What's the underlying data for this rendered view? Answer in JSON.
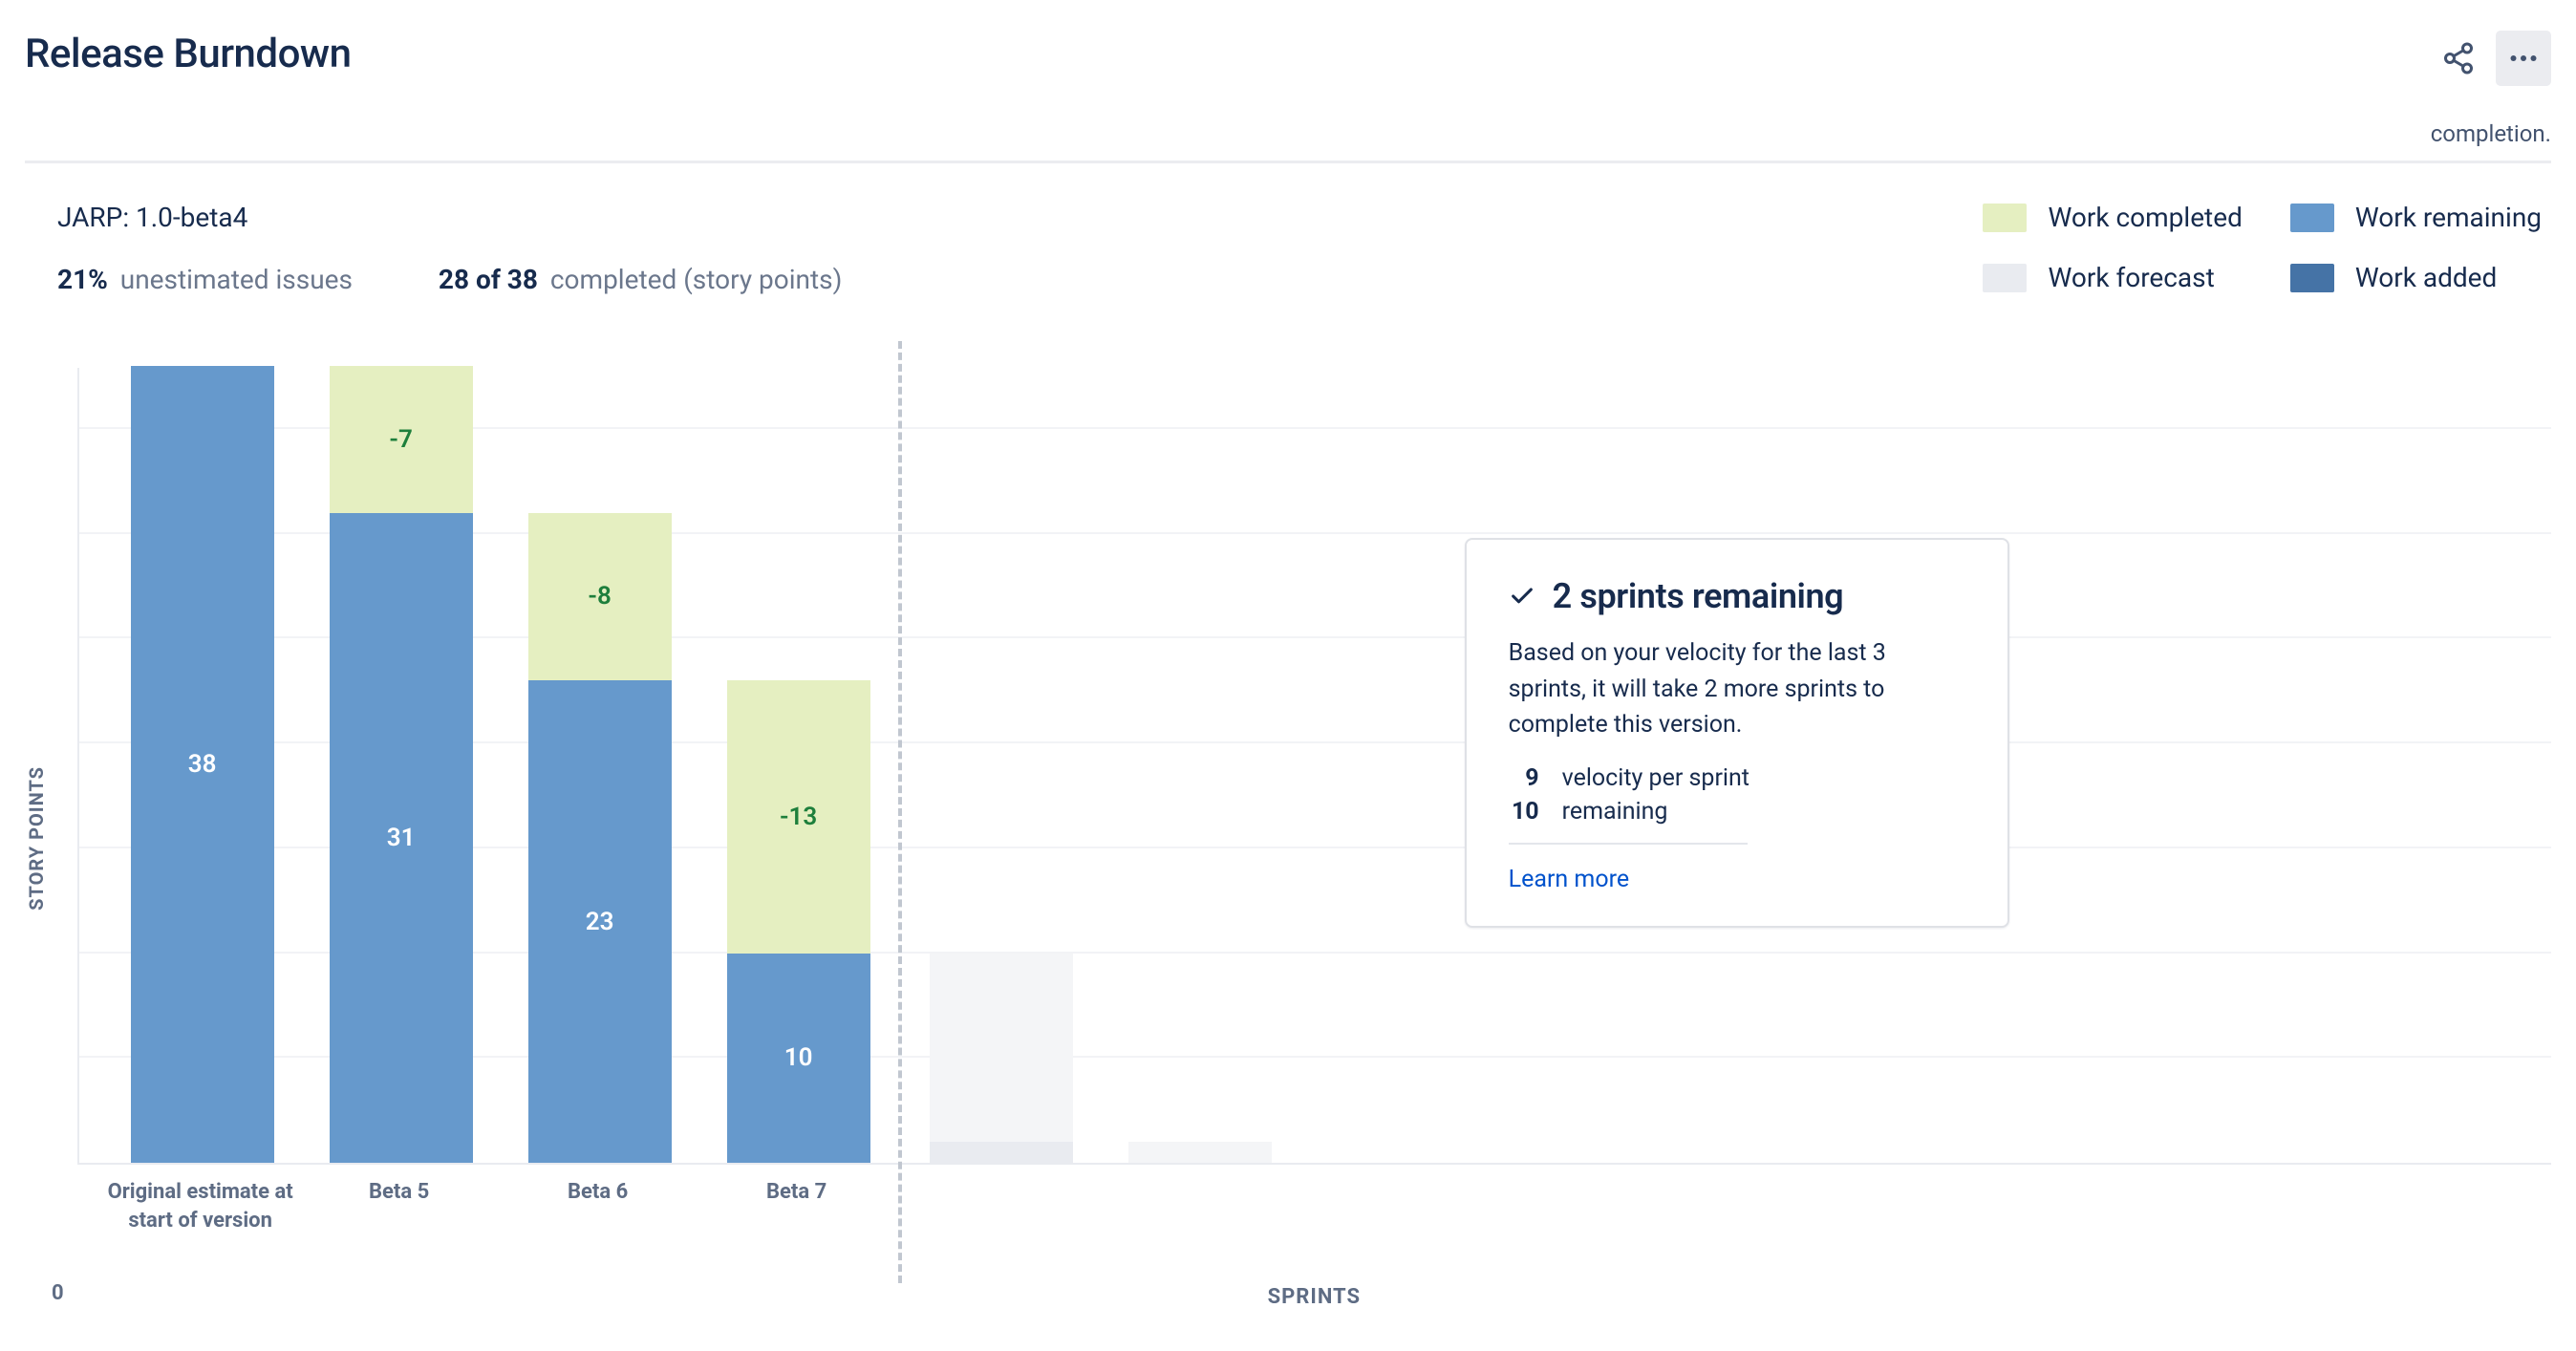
{
  "header": {
    "title": "Release Burndown",
    "meta_right": "completion."
  },
  "sub": {
    "version": "JARP: 1.0-beta4",
    "stat1_value": "21%",
    "stat1_label": "unestimated issues",
    "stat2_value": "28 of 38",
    "stat2_label": "completed (story points)"
  },
  "legend": {
    "work_completed": "Work completed",
    "work_remaining": "Work remaining",
    "work_forecast": "Work forecast",
    "work_added": "Work added",
    "colors": {
      "completed": "#e5efc1",
      "remaining": "#6699cc",
      "forecast": "#e9ebf0",
      "added": "#4573a6"
    }
  },
  "axes": {
    "y_title": "STORY POINTS",
    "y_zero": "0",
    "x_title": "SPRINTS"
  },
  "forecast_card": {
    "title": "2 sprints remaining",
    "body": "Based on your velocity for the last 3 sprints, it will take 2 more sprints to complete this version.",
    "velocity_value": "9",
    "velocity_label": "velocity per sprint",
    "remaining_value": "10",
    "remaining_label": "remaining",
    "learn_more": "Learn more"
  },
  "chart_data": {
    "type": "bar",
    "title": "Release Burndown",
    "xlabel": "SPRINTS",
    "ylabel": "STORY POINTS",
    "ylim": [
      0,
      38
    ],
    "gridlines": [
      5,
      10,
      15,
      20,
      25,
      30,
      35
    ],
    "categories": [
      "Original estimate at start of version",
      "Beta 5",
      "Beta 6",
      "Beta 7"
    ],
    "series": [
      {
        "name": "Work remaining",
        "values": [
          38,
          31,
          23,
          10
        ]
      },
      {
        "name": "Work completed",
        "values": [
          0,
          -7,
          -8,
          -13
        ]
      }
    ],
    "remaining_labels": [
      "38",
      "31",
      "23",
      "10"
    ],
    "completed_labels": [
      "",
      "-7",
      "-8",
      "-13"
    ],
    "totals": [
      38,
      38,
      31,
      23
    ],
    "forecast": [
      {
        "total_top": 10,
        "remaining": 1
      },
      {
        "total_top": 1,
        "remaining": 0
      }
    ]
  }
}
